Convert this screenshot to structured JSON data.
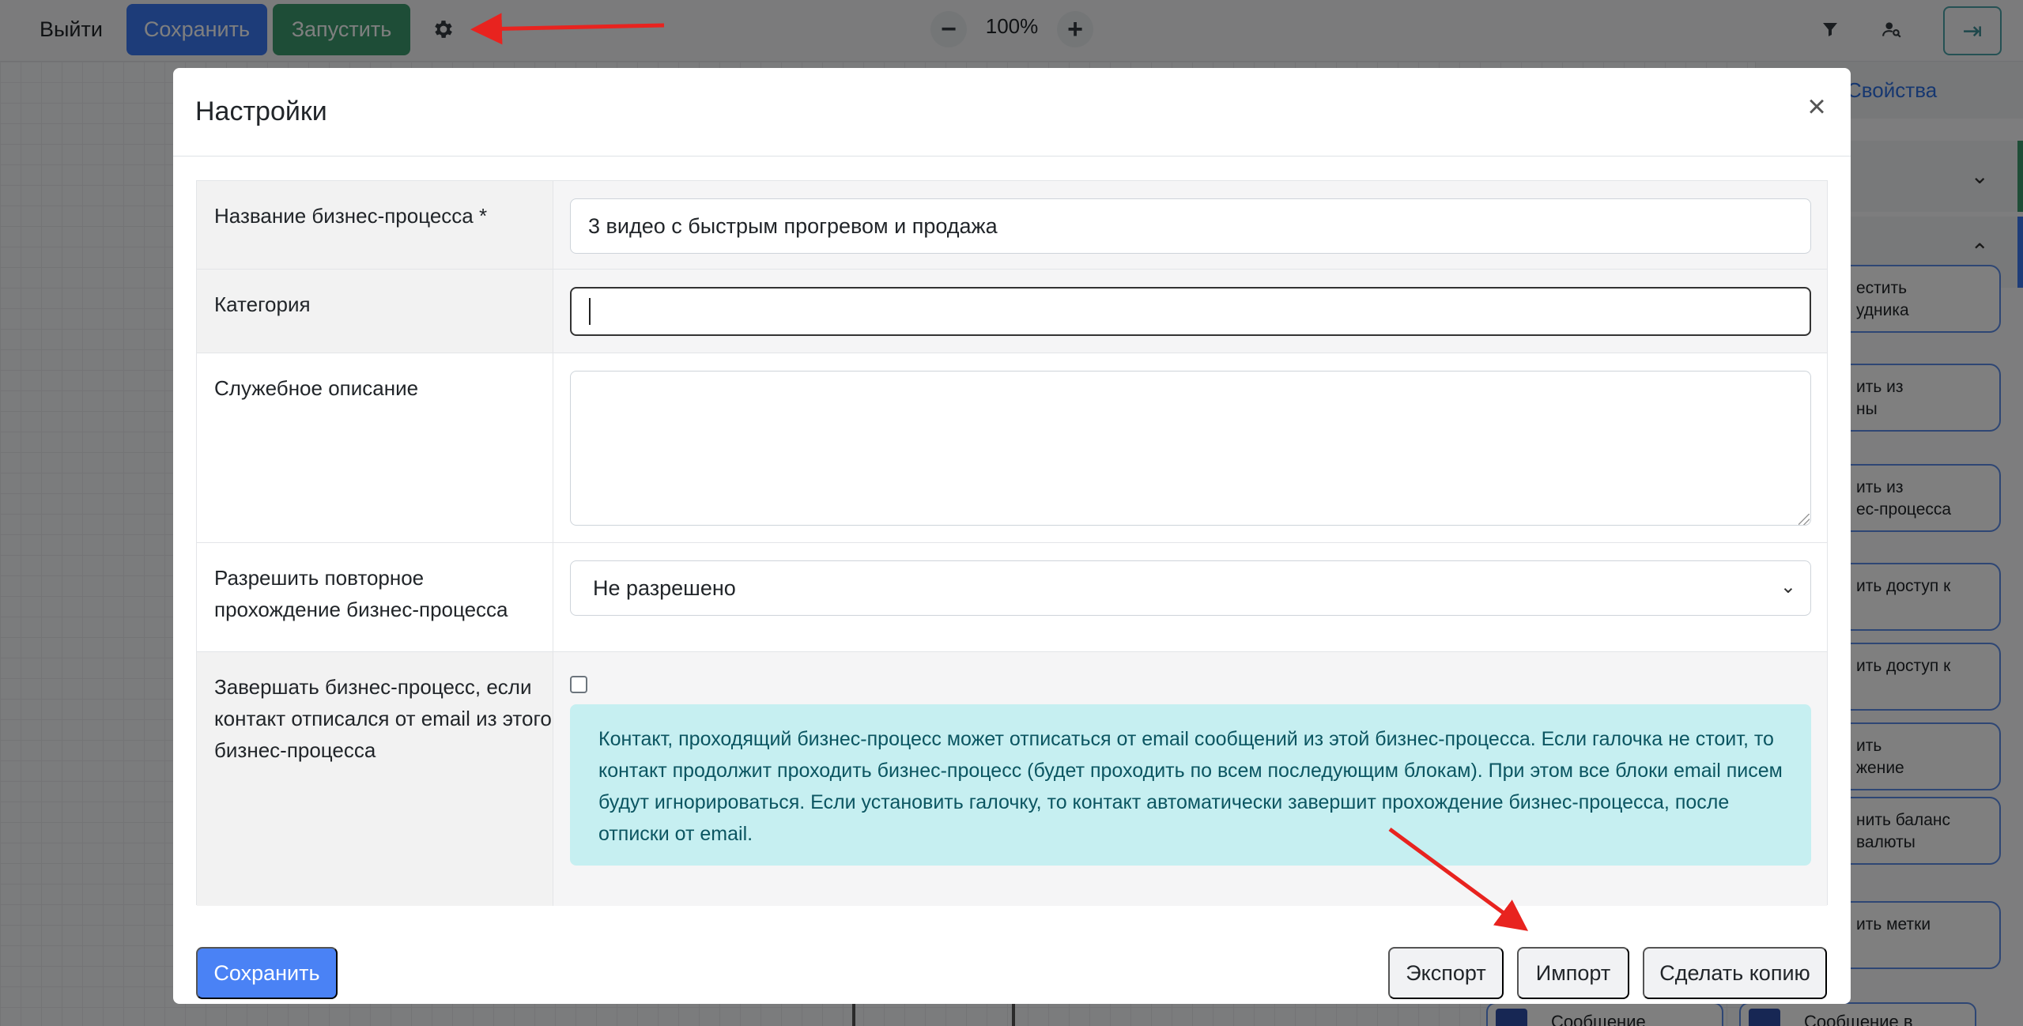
{
  "toolbar": {
    "exit_label": "Выйти",
    "save_label": "Сохранить",
    "run_label": "Запустить",
    "zoom_minus": "−",
    "zoom_value": "100%",
    "zoom_plus": "+",
    "collapse_glyph": "⇥"
  },
  "right_panel": {
    "header": "Свойства",
    "items": [
      "естить\nудника",
      "ить из\nны",
      "ить из\nес-процесса",
      "ить доступ к",
      "ить доступ к",
      "ить\nжение",
      "нить баланс\nвалюты",
      "ить метки"
    ],
    "bottom_cards": [
      "Сообщение",
      "Сообщение в"
    ]
  },
  "modal": {
    "title": "Настройки",
    "close_glyph": "×",
    "fields": {
      "name_label": "Название бизнес-процесса *",
      "name_value": "3 видео с быстрым прогревом и продажа",
      "category_label": "Категория",
      "category_value": "",
      "description_label": "Служебное описание",
      "description_value": "",
      "repeat_label": "Разрешить повторное прохождение бизнес-процесса",
      "repeat_value": "Не разрешено",
      "finish_label": "Завершать бизнес-процесс, если контакт отписался от email из этого бизнес-процесса",
      "finish_checked": false,
      "finish_hint": "Контакт, проходящий бизнес-процесс может отписаться от email сообщений из этой бизнес-процесса. Если галочка не стоит, то контакт продолжит проходить бизнес-процесс (будет проходить по всем последующим блокам). При этом все блоки email писем будут игнорироваться. Если установить галочку, то контакт автоматически завершит прохождение бизнес-процесса, после отписки от email."
    },
    "footer": {
      "save_label": "Сохранить",
      "export_label": "Экспорт",
      "import_label": "Импорт",
      "copy_label": "Сделать копию"
    }
  },
  "icons": {
    "settings": "gear-icon",
    "filter": "filter-icon",
    "user_search": "user-search-icon",
    "close": "close-icon",
    "chevron_down": "chevron-down-icon",
    "chevron_up": "chevron-up-icon"
  },
  "colors": {
    "primary": "#3a78f2",
    "success": "#3c9a6f",
    "alert_bg": "#c6eff1",
    "alert_text": "#0b5561",
    "annotation": "#e8231f"
  }
}
